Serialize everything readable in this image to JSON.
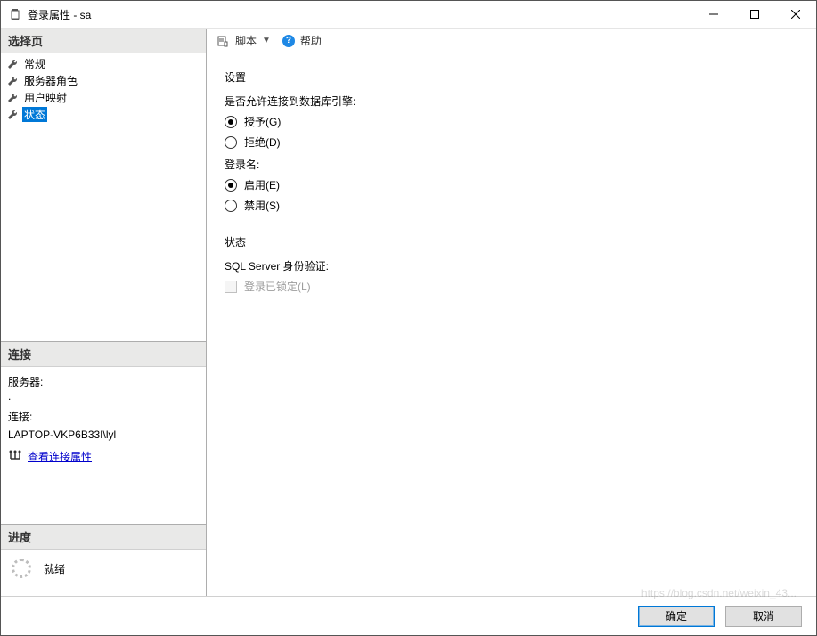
{
  "window": {
    "title": "登录属性 - sa"
  },
  "sidebar": {
    "pages_header": "选择页",
    "items": [
      {
        "label": "常规",
        "selected": false
      },
      {
        "label": "服务器角色",
        "selected": false
      },
      {
        "label": "用户映射",
        "selected": false
      },
      {
        "label": "状态",
        "selected": true
      }
    ],
    "connection": {
      "header": "连接",
      "server_label": "服务器:",
      "server_value": ".",
      "connection_label": "连接:",
      "connection_value": "LAPTOP-VKP6B33I\\lyl",
      "view_props": "查看连接属性"
    },
    "progress": {
      "header": "进度",
      "status": "就绪"
    }
  },
  "toolbar": {
    "script": "脚本",
    "help": "帮助"
  },
  "form": {
    "settings_header": "设置",
    "perm_label": "是否允许连接到数据库引擎:",
    "grant": "授予(G)",
    "deny": "拒绝(D)",
    "login_label": "登录名:",
    "enable": "启用(E)",
    "disable": "禁用(S)",
    "status_header": "状态",
    "sqlauth_label": "SQL Server 身份验证:",
    "locked": "登录已锁定(L)"
  },
  "buttons": {
    "ok": "确定",
    "cancel": "取消"
  },
  "watermark": "https://blog.csdn.net/weixin_43..."
}
